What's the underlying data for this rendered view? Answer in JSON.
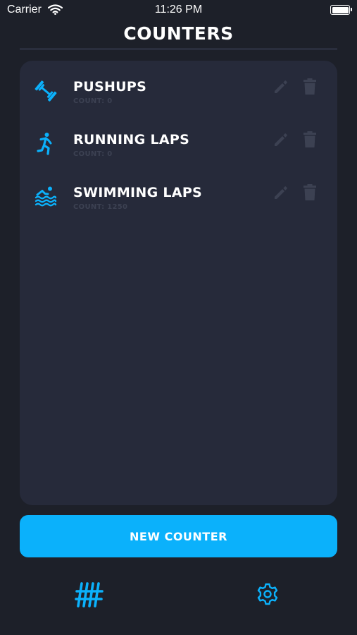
{
  "status_bar": {
    "carrier": "Carrier",
    "time": "11:26 PM"
  },
  "header": {
    "title": "COUNTERS"
  },
  "counters": [
    {
      "name": "PUSHUPS",
      "count_label": "COUNT:",
      "count_value": "0",
      "icon": "dumbbell-icon"
    },
    {
      "name": "RUNNING LAPS",
      "count_label": "COUNT:",
      "count_value": "0",
      "icon": "running-icon"
    },
    {
      "name": "SWIMMING LAPS",
      "count_label": "COUNT:",
      "count_value": "1250",
      "icon": "swimming-icon"
    }
  ],
  "actions": {
    "new_counter_label": "NEW COUNTER"
  },
  "tab_bar": {
    "items": [
      {
        "icon": "tally-icon",
        "active": true
      },
      {
        "icon": "gear-icon",
        "active": false
      }
    ]
  },
  "colors": {
    "background": "#1d2029",
    "card": "#262a3a",
    "accent": "#0bb1fb",
    "muted_icon": "#3c4152"
  }
}
